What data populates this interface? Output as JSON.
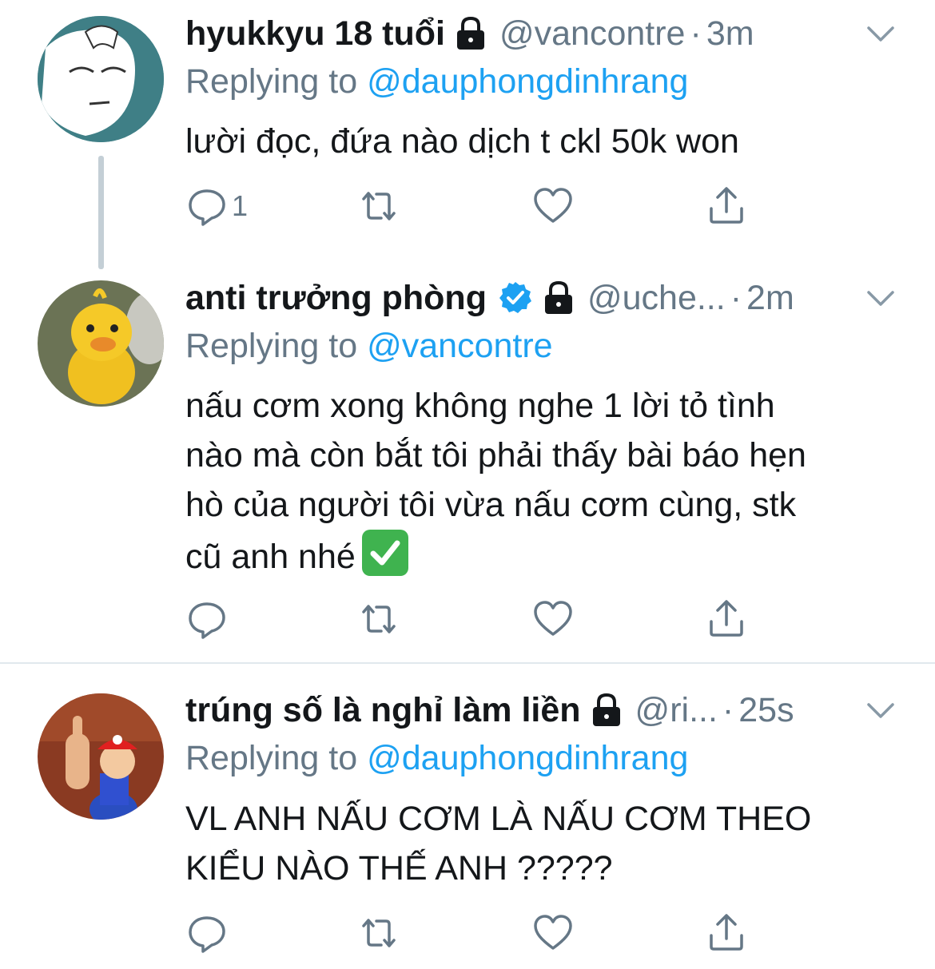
{
  "tweets": [
    {
      "name": "hyukkyu 18 tuổi",
      "handle": "@vancontre",
      "separator": "·",
      "time": "3m",
      "replying_prefix": "Replying to",
      "replying_to": "@dauphongdinhrang",
      "text": "lười đọc, đứa nào dịch t ckl 50k won",
      "reply_count": "1",
      "verified": false,
      "locked": true
    },
    {
      "name": "anti trưởng phòng",
      "handle": "@uche...",
      "separator": "·",
      "time": "2m",
      "replying_prefix": "Replying to",
      "replying_to": "@vancontre",
      "text": "nấu cơm xong không nghe 1 lời tỏ tình\nnào mà còn bắt tôi phải thấy bài báo hẹn\nhò của người tôi vừa nấu cơm cùng, stk\ncũ anh nhé",
      "reply_count": "",
      "verified": true,
      "locked": true
    },
    {
      "name": "trúng số là nghỉ làm liền",
      "handle": "@ri...",
      "separator": "·",
      "time": "25s",
      "replying_prefix": "Replying to",
      "replying_to": "@dauphongdinhrang",
      "text": "VL ANH NẤU CƠM LÀ NẤU CƠM THEO\nKIỂU NÀO THẾ ANH ?????",
      "reply_count": "",
      "verified": false,
      "locked": true
    }
  ],
  "colors": {
    "link": "#1da1f2",
    "secondary_text": "#657786",
    "verified_badge": "#1da1f2",
    "divider": "#e1e8ed"
  },
  "icons": [
    "reply-icon",
    "retweet-icon",
    "like-icon",
    "share-icon",
    "lock-icon",
    "verified-icon",
    "chevron-down-icon"
  ]
}
